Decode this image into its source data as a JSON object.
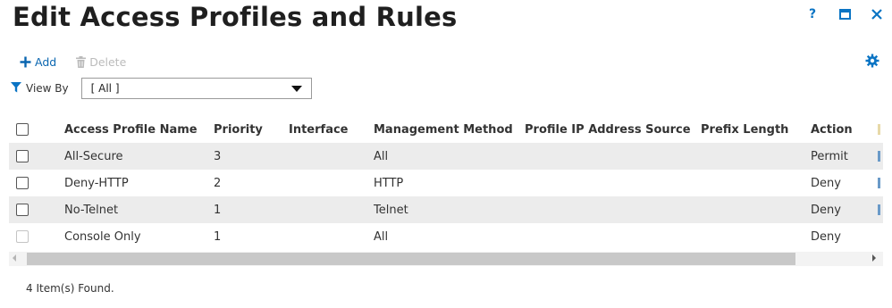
{
  "window": {
    "title": "Edit Access Profiles and Rules",
    "help_label": "?",
    "icons": {
      "help": "help-icon",
      "maximize": "maximize-icon",
      "close": "close-icon",
      "settings": "gear-icon"
    }
  },
  "toolbar": {
    "add_label": "Add",
    "delete_label": "Delete",
    "add_icon": "plus-icon",
    "delete_icon": "trash-icon",
    "delete_enabled": false
  },
  "filter": {
    "view_by_label": "View By",
    "view_by_value": "[ All ]",
    "icon": "filter-icon"
  },
  "table": {
    "columns": [
      "Access Profile Name",
      "Priority",
      "Interface",
      "Management Method",
      "Profile IP Address Source",
      "Prefix Length",
      "Action"
    ],
    "rows": [
      {
        "name": "All-Secure",
        "priority": "3",
        "interface": "",
        "management_method": "All",
        "profile_ip_source": "",
        "prefix_length": "",
        "action": "Permit",
        "checkbox_enabled": true
      },
      {
        "name": "Deny-HTTP",
        "priority": "2",
        "interface": "",
        "management_method": "HTTP",
        "profile_ip_source": "",
        "prefix_length": "",
        "action": "Deny",
        "checkbox_enabled": true
      },
      {
        "name": "No-Telnet",
        "priority": "1",
        "interface": "",
        "management_method": "Telnet",
        "profile_ip_source": "",
        "prefix_length": "",
        "action": "Deny",
        "checkbox_enabled": true
      },
      {
        "name": "Console Only",
        "priority": "1",
        "interface": "",
        "management_method": "All",
        "profile_ip_source": "",
        "prefix_length": "",
        "action": "Deny",
        "checkbox_enabled": false
      }
    ]
  },
  "footer": {
    "count_text": "4 Item(s) Found."
  },
  "colors": {
    "accent": "#0a74c4",
    "row_shade": "#ececec",
    "disabled": "#bbbbbb"
  }
}
